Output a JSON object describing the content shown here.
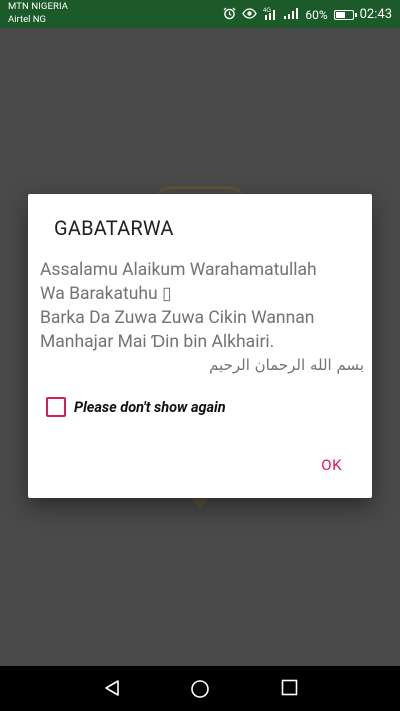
{
  "status_bar": {
    "carrier_1": "MTN NIGERIA",
    "carrier_2": "Airtel NG",
    "network": "4G",
    "battery_percent": "60%",
    "battery_level": 0.6,
    "time": "02:43",
    "icons": [
      "alarm-icon",
      "eye-icon",
      "network-4g-icon",
      "signal-icon",
      "signal-icon",
      "battery-icon"
    ]
  },
  "dialog": {
    "title": "GABATARWA",
    "message_line_1": "Assalamu Alaikum Warahamatullah",
    "message_line_2": "Wa Barakatuhu ▯",
    "message_line_3": "Barka Da Zuwa Zuwa Cikin Wannan",
    "message_line_4": "Manhajar Mai Ɗin bin Alkhairi.",
    "message_arabic": "بسم الله الرحمان الرحيم",
    "checkbox_label": "Please don't show again",
    "checkbox_checked": false,
    "ok_label": "OK"
  },
  "colors": {
    "accent": "#e0115f",
    "status_bar": "#1c5a2a",
    "scrim": "#4e4e4e"
  },
  "navigation_bar": {
    "icons": [
      "back-icon",
      "home-icon",
      "recent-apps-icon"
    ]
  }
}
